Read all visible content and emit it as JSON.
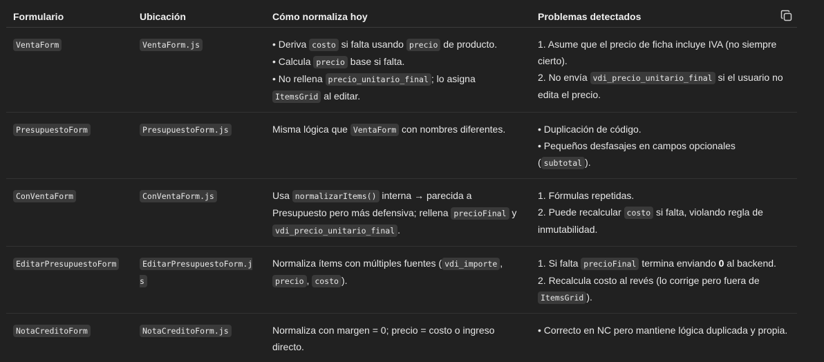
{
  "table": {
    "headers": [
      "Formulario",
      "Ubicación",
      "Cómo normaliza hoy",
      "Problemas detectados"
    ],
    "rows": [
      {
        "form": "VentaForm",
        "file": "VentaForm.js",
        "how": [
          [
            [
              "t",
              "• Deriva "
            ],
            [
              "c",
              "costo"
            ],
            [
              "t",
              " si falta usando "
            ],
            [
              "c",
              "precio"
            ],
            [
              "t",
              " de producto."
            ]
          ],
          [
            [
              "t",
              "• Calcula "
            ],
            [
              "c",
              "precio"
            ],
            [
              "t",
              " base si falta."
            ]
          ],
          [
            [
              "t",
              "• No rellena "
            ],
            [
              "c",
              "precio_unitario_final"
            ],
            [
              "t",
              "; lo asigna "
            ],
            [
              "c",
              "ItemsGrid"
            ],
            [
              "t",
              " al editar."
            ]
          ]
        ],
        "problems": [
          [
            [
              "t",
              "1. Asume que el precio de ficha incluye IVA (no siempre cierto)."
            ]
          ],
          [
            [
              "t",
              "2. No envía "
            ],
            [
              "c",
              "vdi_precio_unitario_final"
            ],
            [
              "t",
              " si el usuario no edita el precio."
            ]
          ]
        ]
      },
      {
        "form": "PresupuestoForm",
        "file": "PresupuestoForm.js",
        "how": [
          [
            [
              "t",
              "Misma lógica que "
            ],
            [
              "c",
              "VentaForm"
            ],
            [
              "t",
              " con nombres diferentes."
            ]
          ]
        ],
        "problems": [
          [
            [
              "t",
              "• Duplicación de código."
            ]
          ],
          [
            [
              "t",
              "• Pequeños desfasajes en campos opcionales ("
            ],
            [
              "c",
              "subtotal"
            ],
            [
              "t",
              ")."
            ]
          ]
        ]
      },
      {
        "form": "ConVentaForm",
        "file": "ConVentaForm.js",
        "how": [
          [
            [
              "t",
              "Usa "
            ],
            [
              "c",
              "normalizarItems()"
            ],
            [
              "t",
              " interna → parecida a Presupuesto pero más defensiva; rellena "
            ],
            [
              "c",
              "precioFinal"
            ],
            [
              "t",
              " y "
            ],
            [
              "c",
              "vdi_precio_unitario_final"
            ],
            [
              "t",
              "."
            ]
          ]
        ],
        "problems": [
          [
            [
              "t",
              "1. Fórmulas repetidas."
            ]
          ],
          [
            [
              "t",
              "2. Puede recalcular "
            ],
            [
              "c",
              "costo"
            ],
            [
              "t",
              " si falta, violando regla de inmutabilidad."
            ]
          ]
        ]
      },
      {
        "form": "EditarPresupuestoForm",
        "file": "EditarPresupuestoForm.js",
        "how": [
          [
            [
              "t",
              "Normaliza ítems con múltiples fuentes ("
            ],
            [
              "c",
              "vdi_importe"
            ],
            [
              "t",
              ", "
            ],
            [
              "c",
              "precio"
            ],
            [
              "t",
              ", "
            ],
            [
              "c",
              "costo"
            ],
            [
              "t",
              ")."
            ]
          ]
        ],
        "problems": [
          [
            [
              "t",
              "1. Si falta "
            ],
            [
              "c",
              "precioFinal"
            ],
            [
              "t",
              " termina enviando "
            ],
            [
              "b",
              "0"
            ],
            [
              "t",
              " al backend."
            ]
          ],
          [
            [
              "t",
              "2. Recalcula costo al revés (lo corrige pero fuera de "
            ],
            [
              "c",
              "ItemsGrid"
            ],
            [
              "t",
              ")."
            ]
          ]
        ]
      },
      {
        "form": "NotaCreditoForm",
        "file": "NotaCreditoForm.js",
        "how": [
          [
            [
              "t",
              "Normaliza con margen = 0; precio = costo o ingreso directo."
            ]
          ]
        ],
        "problems": [
          [
            [
              "t",
              "• Correcto en NC pero mantiene lógica duplicada y propia."
            ]
          ]
        ]
      }
    ]
  },
  "icons": {
    "copy": "copy-icon"
  },
  "colors": {
    "background": "#212121",
    "code_bg": "#3a3a3a",
    "text": "#ececec"
  }
}
